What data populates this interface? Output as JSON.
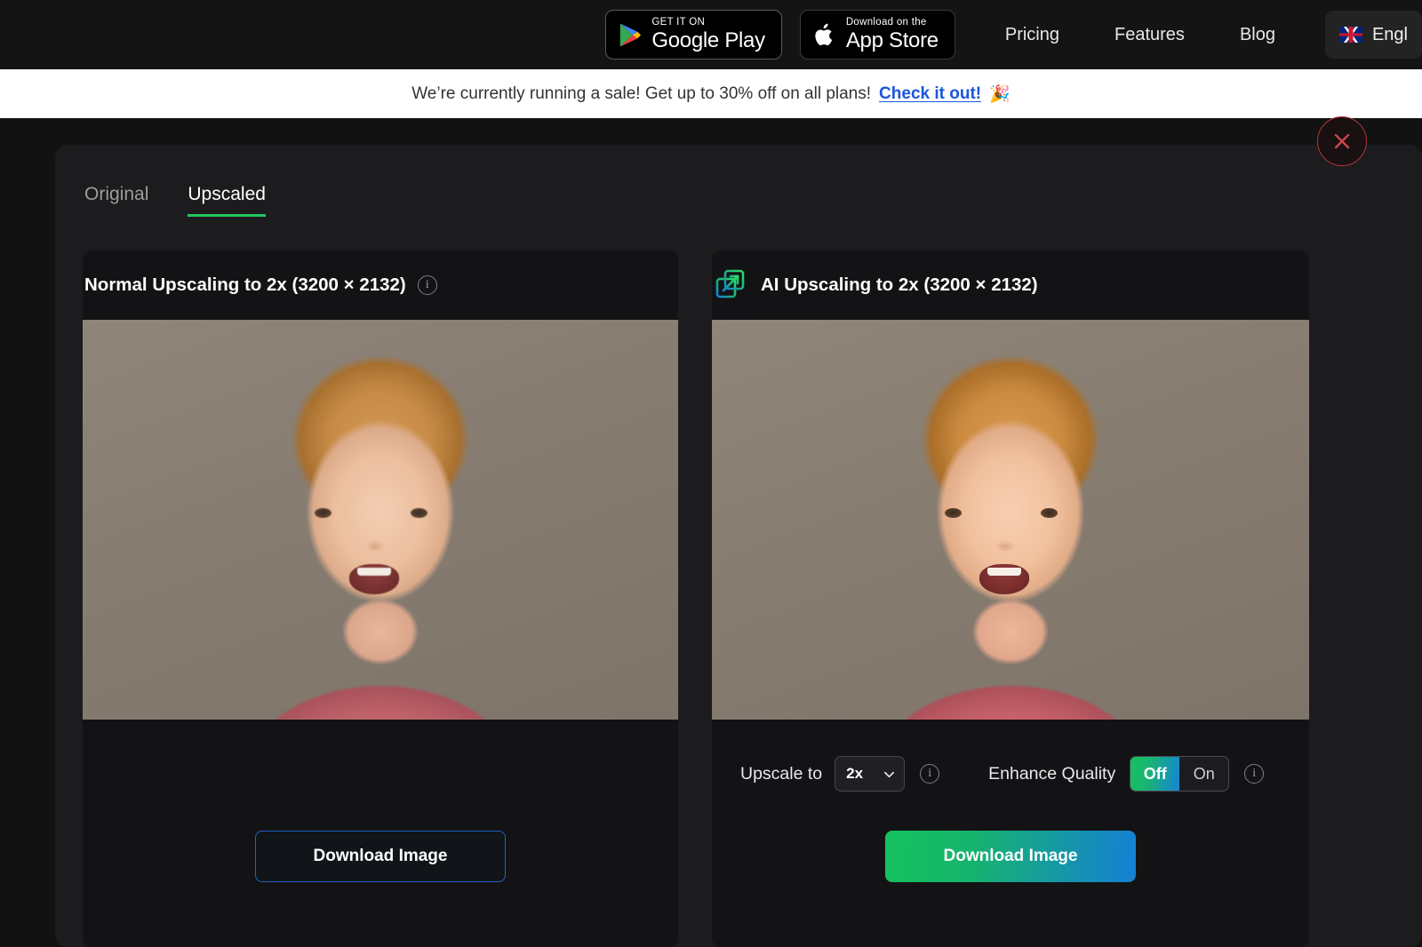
{
  "topnav": {
    "google_play": {
      "small": "GET IT ON",
      "big": "Google Play",
      "icon": "google-play-icon"
    },
    "app_store": {
      "small": "Download on the",
      "big": "App Store",
      "icon": "apple-icon"
    },
    "links": [
      "Pricing",
      "Features",
      "Blog"
    ],
    "language": {
      "label": "Engl",
      "flag": "uk-flag-icon"
    }
  },
  "banner": {
    "text": "We’re currently running a sale! Get up to 30% off on all plans!",
    "link": "Check it out!",
    "emoji": "🎉"
  },
  "modal": {
    "close_icon": "close-icon",
    "tabs": [
      {
        "label": "Original",
        "active": false
      },
      {
        "label": "Upscaled",
        "active": true
      }
    ],
    "left_panel": {
      "title": "Normal Upscaling to 2x (3200 × 2132)",
      "info_icon": "info-icon",
      "image_alt": "toddler-portrait-normal-upscale",
      "download_label": "Download Image"
    },
    "right_panel": {
      "icon": "ai-upscale-icon",
      "title": "AI Upscaling to 2x (3200 × 2132)",
      "image_alt": "toddler-portrait-ai-upscale",
      "controls": {
        "upscale_label": "Upscale to",
        "upscale_value": "2x",
        "upscale_options": [
          "2x"
        ],
        "upscale_info_icon": "info-icon",
        "enhance_label": "Enhance Quality",
        "enhance_off": "Off",
        "enhance_on": "On",
        "enhance_selected": "Off",
        "enhance_info_icon": "info-icon"
      },
      "download_label": "Download Image"
    }
  },
  "colors": {
    "accent_green": "#22c55e",
    "accent_blue": "#1580d6",
    "link_blue": "#1a56db",
    "close_red": "#b3373c",
    "outline_blue": "#1f63c4"
  }
}
